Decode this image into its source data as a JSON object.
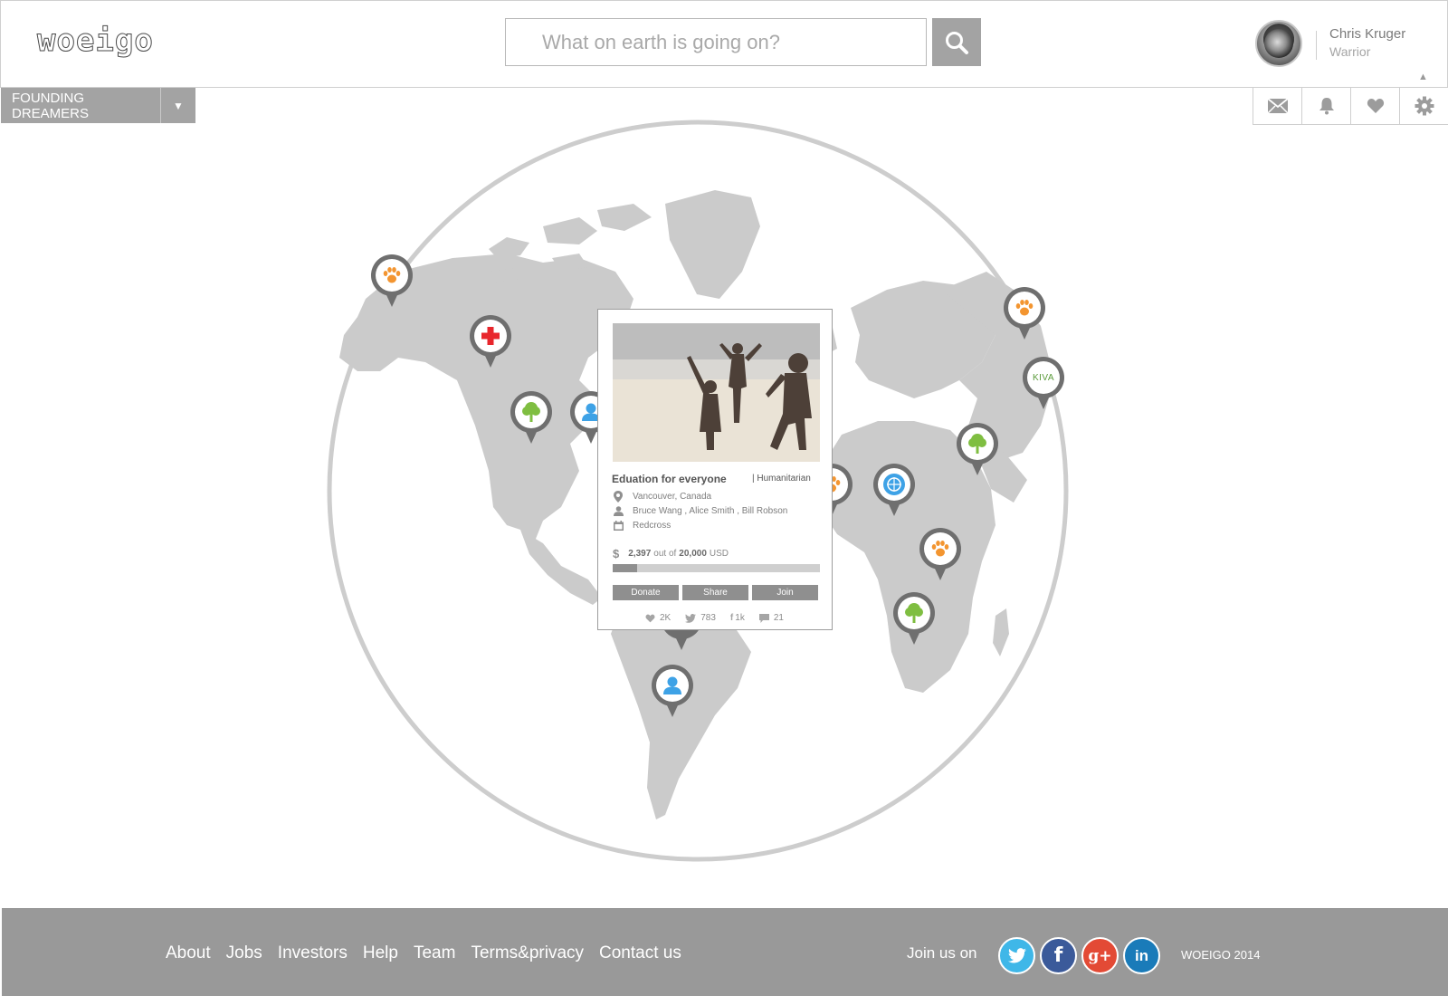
{
  "header": {
    "logo_text": "woeigo",
    "search": {
      "placeholder": "What on earth is going on?"
    },
    "user": {
      "name": "Chris Kruger",
      "role": "Warrior"
    }
  },
  "subbar": {
    "filter": {
      "selected": "FOUNDING DREAMERS"
    },
    "icons": [
      "mail-icon",
      "bell-icon",
      "heart-icon",
      "gear-icon"
    ]
  },
  "map": {
    "pins": [
      {
        "icon": "paw-icon",
        "color": "#f39530"
      },
      {
        "icon": "red-cross-icon",
        "color": "#e8262c"
      },
      {
        "icon": "tree-icon",
        "color": "#7fbe41"
      },
      {
        "icon": "person-icon",
        "color": "#3ea2e6"
      },
      {
        "icon": "person-icon",
        "color": "#3ea2e6"
      },
      {
        "icon": "paw-icon",
        "color": "#f39530"
      },
      {
        "icon": "kiva-logo",
        "color": "#5a9a3a"
      },
      {
        "icon": "tree-icon",
        "color": "#7fbe41"
      },
      {
        "icon": "un-logo",
        "color": "#3ea2e6"
      },
      {
        "icon": "paw-icon",
        "color": "#f39530"
      },
      {
        "icon": "tree-icon",
        "color": "#7fbe41"
      }
    ],
    "kiva_label": "KIVA"
  },
  "card": {
    "title": "Eduation for everyone",
    "category": "| Humanitarian",
    "location": "Vancouver, Canada",
    "people": "Bruce Wang , Alice Smith , Bill Robson",
    "organization": "Redcross",
    "raised": "2,397",
    "out_of_text": "out of",
    "goal": "20,000",
    "currency": "USD",
    "progress_fraction": 0.12,
    "buttons": {
      "donate": "Donate",
      "share": "Share",
      "join": "Join"
    },
    "stats": {
      "likes": "2K",
      "tweets": "783",
      "facebook": "1k",
      "comments": "21"
    }
  },
  "footer": {
    "links": [
      "About",
      "Jobs",
      "Investors",
      "Help",
      "Team",
      "Terms&privacy",
      "Contact us"
    ],
    "join_label": "Join us on",
    "socials": [
      {
        "name": "twitter",
        "color": "#3fb7e8"
      },
      {
        "name": "facebook",
        "color": "#3b5a9a"
      },
      {
        "name": "google-plus",
        "color": "#e34a35"
      },
      {
        "name": "linkedin",
        "color": "#1a7bb9"
      }
    ],
    "copyright": "WOEIGO 2014"
  }
}
